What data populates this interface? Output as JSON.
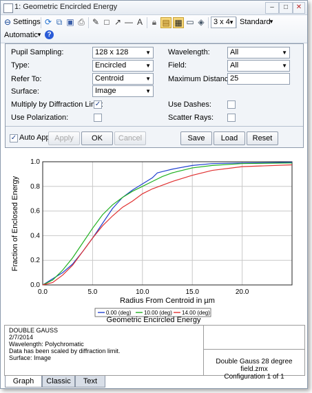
{
  "window": {
    "title": "1: Geometric Encircled Energy"
  },
  "toolbar": {
    "settings_label": "Settings",
    "layout_value": "3 x 4",
    "style_value": "Standard",
    "automatic_label": "Automatic",
    "help_label": "?"
  },
  "form": {
    "pupil_sampling": {
      "label": "Pupil Sampling:",
      "value": "128 x 128"
    },
    "type": {
      "label": "Type:",
      "value": "Encircled"
    },
    "refer_to": {
      "label": "Refer To:",
      "value": "Centroid"
    },
    "surface": {
      "label": "Surface:",
      "value": "Image"
    },
    "multiply": {
      "label": "Multiply by Diffraction Limit:",
      "checked": true
    },
    "use_polarization": {
      "label": "Use Polarization:",
      "checked": false
    },
    "wavelength": {
      "label": "Wavelength:",
      "value": "All"
    },
    "field": {
      "label": "Field:",
      "value": "All"
    },
    "max_distance": {
      "label": "Maximum Distance:",
      "value": "25"
    },
    "use_dashes": {
      "label": "Use Dashes:",
      "checked": false
    },
    "scatter_rays": {
      "label": "Scatter Rays:",
      "checked": false
    }
  },
  "buttons": {
    "auto_apply": "Auto Apply",
    "apply": "Apply",
    "ok": "OK",
    "cancel": "Cancel",
    "save": "Save",
    "load": "Load",
    "reset": "Reset"
  },
  "chart_data": {
    "type": "line",
    "xlabel": "Radius From Centroid in µm",
    "ylabel": "Fraction of Enclosed Energy",
    "xlim": [
      0,
      25
    ],
    "ylim": [
      0,
      1.0
    ],
    "xticks": [
      "0.0",
      "5.0",
      "10.0",
      "15.0",
      "20.0"
    ],
    "xtick_values": [
      0,
      5,
      10,
      15,
      20
    ],
    "yticks": [
      "0.0",
      "0.2",
      "0.4",
      "0.6",
      "0.8",
      "1.0"
    ],
    "ytick_values": [
      0,
      0.2,
      0.4,
      0.6,
      0.8,
      1.0
    ],
    "grid": true,
    "legend_position": "bottom",
    "series": [
      {
        "name": "0.00 (deg)",
        "color": "#2040d0",
        "x": [
          0,
          1,
          2,
          3,
          4,
          5,
          6,
          7,
          8,
          9,
          10,
          11,
          11.5,
          12,
          13,
          15,
          17,
          20,
          25
        ],
        "y": [
          0,
          0.05,
          0.1,
          0.17,
          0.27,
          0.38,
          0.5,
          0.62,
          0.71,
          0.77,
          0.82,
          0.87,
          0.91,
          0.92,
          0.94,
          0.97,
          0.985,
          0.99,
          0.995
        ]
      },
      {
        "name": "10.00 (deg)",
        "color": "#20b020",
        "x": [
          0,
          1,
          2,
          3,
          4,
          5,
          6,
          7,
          8,
          9,
          10,
          11,
          12,
          13,
          15,
          17,
          20,
          25
        ],
        "y": [
          0,
          0.04,
          0.12,
          0.22,
          0.34,
          0.46,
          0.57,
          0.65,
          0.71,
          0.76,
          0.8,
          0.84,
          0.88,
          0.91,
          0.95,
          0.97,
          0.985,
          0.99
        ]
      },
      {
        "name": "14.00 (deg)",
        "color": "#e03030",
        "x": [
          0,
          1,
          2,
          3,
          4,
          5,
          6,
          7,
          8,
          9,
          10,
          11,
          12,
          13,
          15,
          17,
          20,
          25
        ],
        "y": [
          0,
          0.02,
          0.08,
          0.16,
          0.27,
          0.38,
          0.48,
          0.56,
          0.63,
          0.68,
          0.74,
          0.78,
          0.81,
          0.84,
          0.89,
          0.93,
          0.96,
          0.975
        ]
      }
    ]
  },
  "plot_title": "Geometric Encircled Energy",
  "info": {
    "lines": [
      "DOUBLE GAUSS",
      "2/7/2014",
      "Wavelength: Polychromatic",
      "Data has been scaled by diffraction limit.",
      "Surface: Image"
    ],
    "file": "Double Gauss 28 degree field.zmx",
    "config": "Configuration 1 of 1"
  },
  "tabs": [
    "Graph",
    "Classic",
    "Text"
  ]
}
